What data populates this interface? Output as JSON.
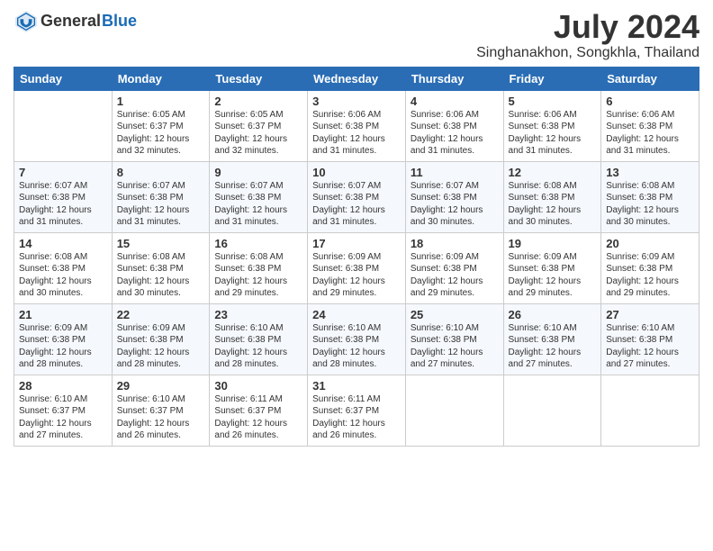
{
  "header": {
    "logo_line1": "General",
    "logo_line2": "Blue",
    "month_year": "July 2024",
    "location": "Singhanakhon, Songkhla, Thailand"
  },
  "weekdays": [
    "Sunday",
    "Monday",
    "Tuesday",
    "Wednesday",
    "Thursday",
    "Friday",
    "Saturday"
  ],
  "weeks": [
    [
      {
        "day": "",
        "sunrise": "",
        "sunset": "",
        "daylight": ""
      },
      {
        "day": "1",
        "sunrise": "Sunrise: 6:05 AM",
        "sunset": "Sunset: 6:37 PM",
        "daylight": "Daylight: 12 hours and 32 minutes."
      },
      {
        "day": "2",
        "sunrise": "Sunrise: 6:05 AM",
        "sunset": "Sunset: 6:37 PM",
        "daylight": "Daylight: 12 hours and 32 minutes."
      },
      {
        "day": "3",
        "sunrise": "Sunrise: 6:06 AM",
        "sunset": "Sunset: 6:38 PM",
        "daylight": "Daylight: 12 hours and 31 minutes."
      },
      {
        "day": "4",
        "sunrise": "Sunrise: 6:06 AM",
        "sunset": "Sunset: 6:38 PM",
        "daylight": "Daylight: 12 hours and 31 minutes."
      },
      {
        "day": "5",
        "sunrise": "Sunrise: 6:06 AM",
        "sunset": "Sunset: 6:38 PM",
        "daylight": "Daylight: 12 hours and 31 minutes."
      },
      {
        "day": "6",
        "sunrise": "Sunrise: 6:06 AM",
        "sunset": "Sunset: 6:38 PM",
        "daylight": "Daylight: 12 hours and 31 minutes."
      }
    ],
    [
      {
        "day": "7",
        "sunrise": "Sunrise: 6:07 AM",
        "sunset": "Sunset: 6:38 PM",
        "daylight": "Daylight: 12 hours and 31 minutes."
      },
      {
        "day": "8",
        "sunrise": "Sunrise: 6:07 AM",
        "sunset": "Sunset: 6:38 PM",
        "daylight": "Daylight: 12 hours and 31 minutes."
      },
      {
        "day": "9",
        "sunrise": "Sunrise: 6:07 AM",
        "sunset": "Sunset: 6:38 PM",
        "daylight": "Daylight: 12 hours and 31 minutes."
      },
      {
        "day": "10",
        "sunrise": "Sunrise: 6:07 AM",
        "sunset": "Sunset: 6:38 PM",
        "daylight": "Daylight: 12 hours and 31 minutes."
      },
      {
        "day": "11",
        "sunrise": "Sunrise: 6:07 AM",
        "sunset": "Sunset: 6:38 PM",
        "daylight": "Daylight: 12 hours and 30 minutes."
      },
      {
        "day": "12",
        "sunrise": "Sunrise: 6:08 AM",
        "sunset": "Sunset: 6:38 PM",
        "daylight": "Daylight: 12 hours and 30 minutes."
      },
      {
        "day": "13",
        "sunrise": "Sunrise: 6:08 AM",
        "sunset": "Sunset: 6:38 PM",
        "daylight": "Daylight: 12 hours and 30 minutes."
      }
    ],
    [
      {
        "day": "14",
        "sunrise": "Sunrise: 6:08 AM",
        "sunset": "Sunset: 6:38 PM",
        "daylight": "Daylight: 12 hours and 30 minutes."
      },
      {
        "day": "15",
        "sunrise": "Sunrise: 6:08 AM",
        "sunset": "Sunset: 6:38 PM",
        "daylight": "Daylight: 12 hours and 30 minutes."
      },
      {
        "day": "16",
        "sunrise": "Sunrise: 6:08 AM",
        "sunset": "Sunset: 6:38 PM",
        "daylight": "Daylight: 12 hours and 29 minutes."
      },
      {
        "day": "17",
        "sunrise": "Sunrise: 6:09 AM",
        "sunset": "Sunset: 6:38 PM",
        "daylight": "Daylight: 12 hours and 29 minutes."
      },
      {
        "day": "18",
        "sunrise": "Sunrise: 6:09 AM",
        "sunset": "Sunset: 6:38 PM",
        "daylight": "Daylight: 12 hours and 29 minutes."
      },
      {
        "day": "19",
        "sunrise": "Sunrise: 6:09 AM",
        "sunset": "Sunset: 6:38 PM",
        "daylight": "Daylight: 12 hours and 29 minutes."
      },
      {
        "day": "20",
        "sunrise": "Sunrise: 6:09 AM",
        "sunset": "Sunset: 6:38 PM",
        "daylight": "Daylight: 12 hours and 29 minutes."
      }
    ],
    [
      {
        "day": "21",
        "sunrise": "Sunrise: 6:09 AM",
        "sunset": "Sunset: 6:38 PM",
        "daylight": "Daylight: 12 hours and 28 minutes."
      },
      {
        "day": "22",
        "sunrise": "Sunrise: 6:09 AM",
        "sunset": "Sunset: 6:38 PM",
        "daylight": "Daylight: 12 hours and 28 minutes."
      },
      {
        "day": "23",
        "sunrise": "Sunrise: 6:10 AM",
        "sunset": "Sunset: 6:38 PM",
        "daylight": "Daylight: 12 hours and 28 minutes."
      },
      {
        "day": "24",
        "sunrise": "Sunrise: 6:10 AM",
        "sunset": "Sunset: 6:38 PM",
        "daylight": "Daylight: 12 hours and 28 minutes."
      },
      {
        "day": "25",
        "sunrise": "Sunrise: 6:10 AM",
        "sunset": "Sunset: 6:38 PM",
        "daylight": "Daylight: 12 hours and 27 minutes."
      },
      {
        "day": "26",
        "sunrise": "Sunrise: 6:10 AM",
        "sunset": "Sunset: 6:38 PM",
        "daylight": "Daylight: 12 hours and 27 minutes."
      },
      {
        "day": "27",
        "sunrise": "Sunrise: 6:10 AM",
        "sunset": "Sunset: 6:38 PM",
        "daylight": "Daylight: 12 hours and 27 minutes."
      }
    ],
    [
      {
        "day": "28",
        "sunrise": "Sunrise: 6:10 AM",
        "sunset": "Sunset: 6:37 PM",
        "daylight": "Daylight: 12 hours and 27 minutes."
      },
      {
        "day": "29",
        "sunrise": "Sunrise: 6:10 AM",
        "sunset": "Sunset: 6:37 PM",
        "daylight": "Daylight: 12 hours and 26 minutes."
      },
      {
        "day": "30",
        "sunrise": "Sunrise: 6:11 AM",
        "sunset": "Sunset: 6:37 PM",
        "daylight": "Daylight: 12 hours and 26 minutes."
      },
      {
        "day": "31",
        "sunrise": "Sunrise: 6:11 AM",
        "sunset": "Sunset: 6:37 PM",
        "daylight": "Daylight: 12 hours and 26 minutes."
      },
      {
        "day": "",
        "sunrise": "",
        "sunset": "",
        "daylight": ""
      },
      {
        "day": "",
        "sunrise": "",
        "sunset": "",
        "daylight": ""
      },
      {
        "day": "",
        "sunrise": "",
        "sunset": "",
        "daylight": ""
      }
    ]
  ]
}
